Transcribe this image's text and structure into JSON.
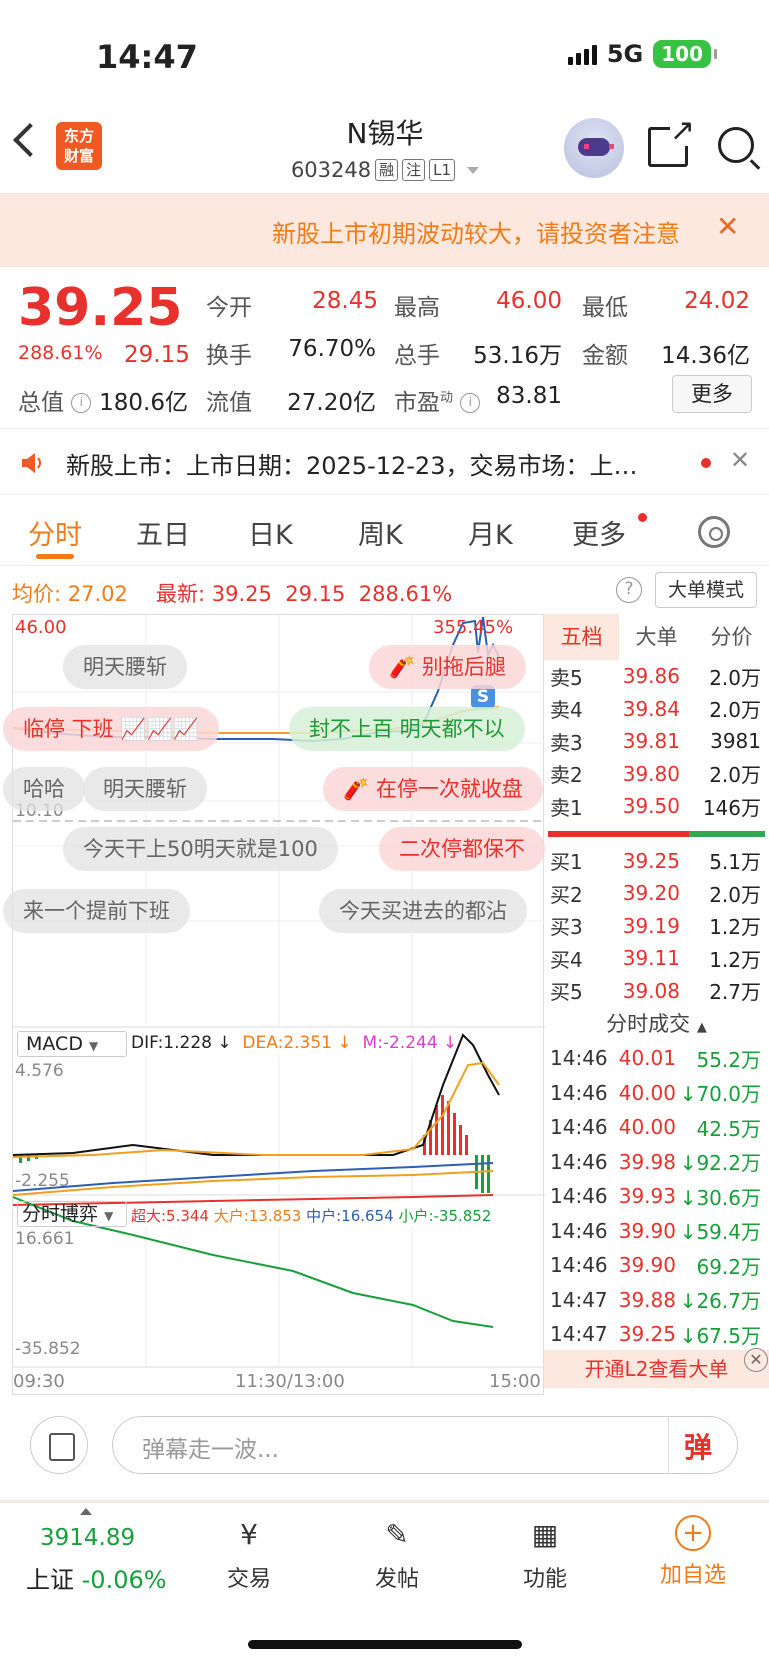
{
  "status_bar": {
    "time": "14:47",
    "network": "5G",
    "battery": "100"
  },
  "header": {
    "logo_line1": "东方",
    "logo_line2": "财富",
    "title": "N锡华",
    "code": "603248",
    "tags": [
      "融",
      "注",
      "L1"
    ]
  },
  "notice": {
    "text": "新股上市初期波动较大，请投资者注意",
    "close": "✕"
  },
  "quote": {
    "price": "39.25",
    "change_pct": "288.61%",
    "change": "29.15",
    "fields": [
      {
        "label": "今开",
        "value": "28.45"
      },
      {
        "label": "最高",
        "value": "46.00"
      },
      {
        "label": "最低",
        "value": "24.02"
      },
      {
        "label": "换手",
        "value": "76.70%"
      },
      {
        "label": "总手",
        "value": "53.16万"
      },
      {
        "label": "金额",
        "value": "14.36亿"
      },
      {
        "label": "总值",
        "value": "180.6亿"
      },
      {
        "label": "流值",
        "value": "27.20亿"
      },
      {
        "label": "市盈",
        "sup": "动",
        "value": "83.81"
      }
    ],
    "more_label": "更多"
  },
  "ipo_bar": {
    "text": "新股上市：上市日期：2025-12-23，交易市场：上…",
    "close": "✕"
  },
  "tabs": [
    "分时",
    "五日",
    "日K",
    "周K",
    "月K",
    "更多"
  ],
  "price_line": {
    "avg_label": "均价:",
    "avg": "27.02",
    "latest_label": "最新:",
    "latest": "39.25",
    "change": "29.15",
    "pct": "288.61%",
    "help": "?",
    "big_order_mode": "大单模式"
  },
  "chart": {
    "top_price": "46.00",
    "top_pct": "355.45%",
    "mid_price": "10.10",
    "macd": {
      "selector": "MACD",
      "dif": "DIF:1.228 ↓",
      "dea": "DEA:2.351 ↓",
      "m": "M:-2.244 ↓",
      "high": "4.576",
      "low": "-2.255"
    },
    "flow": {
      "selector": "分时博弈",
      "super": "超大:5.344",
      "large": "大户:13.853",
      "mid": "中户:16.654",
      "small": "小户:-35.852",
      "high": "16.661",
      "low": "-35.852"
    },
    "time_labels": [
      "09:30",
      "11:30/13:00",
      "15:00"
    ],
    "s_badge": "S",
    "danmu": [
      "明天腰斩",
      "别拖后腿",
      "临停 下班",
      "封不上百 明天都不以",
      "哈哈",
      "明天腰斩",
      "在停一次就收盘",
      "今天干上50明天就是100",
      "二次停都保不",
      "来一个提前下班",
      "今天买进去的都沾"
    ]
  },
  "order_book": {
    "tabs": [
      "五档",
      "大单",
      "分价"
    ],
    "asks": [
      {
        "name": "卖5",
        "price": "39.86",
        "vol": "2.0万"
      },
      {
        "name": "卖4",
        "price": "39.84",
        "vol": "2.0万"
      },
      {
        "name": "卖3",
        "price": "39.81",
        "vol": "3981"
      },
      {
        "name": "卖2",
        "price": "39.80",
        "vol": "2.0万"
      },
      {
        "name": "卖1",
        "price": "39.50",
        "vol": "146万"
      }
    ],
    "bids": [
      {
        "name": "买1",
        "price": "39.25",
        "vol": "5.1万"
      },
      {
        "name": "买2",
        "price": "39.20",
        "vol": "2.0万"
      },
      {
        "name": "买3",
        "price": "39.19",
        "vol": "1.2万"
      },
      {
        "name": "买4",
        "price": "39.11",
        "vol": "1.2万"
      },
      {
        "name": "买5",
        "price": "39.08",
        "vol": "2.7万"
      }
    ],
    "ticks_title": "分时成交",
    "ticks": [
      {
        "time": "14:46",
        "price": "40.01",
        "vol": "55.2万",
        "dir": ""
      },
      {
        "time": "14:46",
        "price": "40.00",
        "vol": "↓70.0万",
        "dir": "down"
      },
      {
        "time": "14:46",
        "price": "40.00",
        "vol": "42.5万",
        "dir": ""
      },
      {
        "time": "14:46",
        "price": "39.98",
        "vol": "↓92.2万",
        "dir": "down"
      },
      {
        "time": "14:46",
        "price": "39.93",
        "vol": "↓30.6万",
        "dir": "down"
      },
      {
        "time": "14:46",
        "price": "39.90",
        "vol": "↓59.4万",
        "dir": "down"
      },
      {
        "time": "14:46",
        "price": "39.90",
        "vol": "69.2万",
        "dir": ""
      },
      {
        "time": "14:47",
        "price": "39.88",
        "vol": "↓26.7万",
        "dir": "down"
      },
      {
        "time": "14:47",
        "price": "39.25",
        "vol": "↓67.5万",
        "dir": "down"
      }
    ],
    "l2_label": "开通L2查看大单",
    "l2_close": "✕"
  },
  "comment_bar": {
    "placeholder": "弹幕走一波...",
    "danmu_btn": "弹"
  },
  "bottom_nav": {
    "index_value": "3914.89",
    "index_name": "上证",
    "index_change": "-0.06%",
    "items": [
      "交易",
      "发帖",
      "功能",
      "加自选"
    ]
  }
}
